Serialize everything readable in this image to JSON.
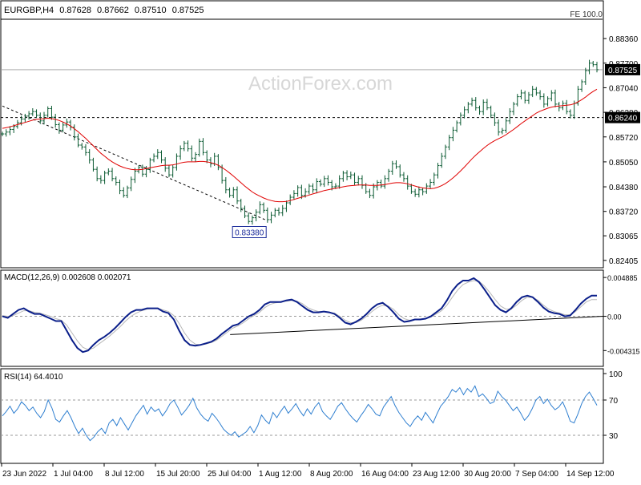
{
  "header": {
    "symbol": "EURGBP,H4",
    "ohlc": [
      "0.87628",
      "0.87662",
      "0.87510",
      "0.87525"
    ],
    "fe_label": "FE 100.0"
  },
  "watermark": "ActionForex.com",
  "colors": {
    "price": "#0b5a32",
    "ma": "#e00000",
    "macd": "#0b1f8a",
    "signal": "#b8b8b8",
    "rsi": "#2f7fd0",
    "frame": "#000000",
    "grid": "#9a9a9a"
  },
  "chart_data": [
    {
      "name": "price",
      "type": "line",
      "title": "EURGBP,H4",
      "y_ticks": [
        "0.88360",
        "0.87700",
        "0.87040",
        "0.86380",
        "0.85720",
        "0.85050",
        "0.84380",
        "0.83720",
        "0.83065",
        "0.82405"
      ],
      "ylim": [
        0.8225,
        0.8875
      ],
      "current_price": {
        "value": 0.87525,
        "label": "0.87525"
      },
      "support_level": {
        "value": 0.8624,
        "label": "0.86240"
      },
      "low_annotation": {
        "value": 0.8338,
        "label": "0.83380",
        "index": 65
      },
      "trendline": {
        "from": [
          0,
          0.8655
        ],
        "to": [
          70,
          0.8347
        ]
      },
      "series": [
        {
          "values": [
            0.858,
            0.8585,
            0.8592,
            0.86,
            0.861,
            0.862,
            0.8628,
            0.8634,
            0.864,
            0.863,
            0.8615,
            0.863,
            0.8648,
            0.8625,
            0.8605,
            0.859,
            0.8604,
            0.8612,
            0.8598,
            0.8572,
            0.855,
            0.8545,
            0.853,
            0.851,
            0.8485,
            0.846,
            0.8455,
            0.8475,
            0.848,
            0.846,
            0.845,
            0.8428,
            0.8415,
            0.8435,
            0.8458,
            0.848,
            0.849,
            0.8472,
            0.8485,
            0.851,
            0.852,
            0.853,
            0.851,
            0.8488,
            0.847,
            0.849,
            0.852,
            0.854,
            0.8555,
            0.854,
            0.8515,
            0.8525,
            0.856,
            0.853,
            0.851,
            0.85,
            0.852,
            0.849,
            0.8455,
            0.843,
            0.8415,
            0.843,
            0.84,
            0.838,
            0.836,
            0.8345,
            0.8355,
            0.837,
            0.839,
            0.8375,
            0.835,
            0.8362,
            0.8375,
            0.8368,
            0.838,
            0.8395,
            0.841,
            0.842,
            0.8436,
            0.8415,
            0.8425,
            0.844,
            0.843,
            0.8452,
            0.8445,
            0.846,
            0.845,
            0.8438,
            0.844,
            0.846,
            0.8475,
            0.8465,
            0.847,
            0.845,
            0.846,
            0.8442,
            0.8425,
            0.8415,
            0.8438,
            0.845,
            0.844,
            0.846,
            0.848,
            0.85,
            0.8492,
            0.847,
            0.846,
            0.844,
            0.8425,
            0.8418,
            0.843,
            0.8425,
            0.844,
            0.845,
            0.847,
            0.8495,
            0.852,
            0.8545,
            0.857,
            0.859,
            0.861,
            0.863,
            0.8645,
            0.866,
            0.867,
            0.865,
            0.864,
            0.8665,
            0.865,
            0.863,
            0.861,
            0.8585,
            0.859,
            0.8615,
            0.864,
            0.866,
            0.868,
            0.869,
            0.867,
            0.8685,
            0.87,
            0.869,
            0.868,
            0.866,
            0.8675,
            0.869,
            0.866,
            0.865,
            0.8662,
            0.864,
            0.863,
            0.8662,
            0.87,
            0.872,
            0.875,
            0.877,
            0.8766,
            0.87525
          ]
        },
        {
          "name": "ma",
          "values": [
            0.8595,
            0.8597,
            0.8599,
            0.8602,
            0.8605,
            0.8608,
            0.8611,
            0.8614,
            0.8617,
            0.8619,
            0.862,
            0.8621,
            0.8622,
            0.8621,
            0.8619,
            0.8616,
            0.8612,
            0.8607,
            0.8601,
            0.8594,
            0.8586,
            0.8577,
            0.8568,
            0.8558,
            0.8548,
            0.8538,
            0.8528,
            0.852,
            0.8512,
            0.8505,
            0.8499,
            0.8494,
            0.849,
            0.8487,
            0.8485,
            0.8484,
            0.8484,
            0.8485,
            0.8487,
            0.8489,
            0.8491,
            0.8493,
            0.8495,
            0.8496,
            0.8496,
            0.8497,
            0.8499,
            0.8502,
            0.8504,
            0.8505,
            0.8505,
            0.8505,
            0.8506,
            0.8506,
            0.8505,
            0.8503,
            0.85,
            0.8496,
            0.849,
            0.8483,
            0.8475,
            0.8467,
            0.8458,
            0.8449,
            0.844,
            0.8432,
            0.8424,
            0.8418,
            0.8413,
            0.8408,
            0.8404,
            0.8401,
            0.8399,
            0.8398,
            0.8398,
            0.8399,
            0.8401,
            0.8404,
            0.8407,
            0.841,
            0.8413,
            0.8416,
            0.8419,
            0.8422,
            0.8425,
            0.8428,
            0.843,
            0.8432,
            0.8434,
            0.8436,
            0.8438,
            0.844,
            0.8441,
            0.8442,
            0.8443,
            0.8443,
            0.8443,
            0.8442,
            0.8442,
            0.8442,
            0.8443,
            0.8444,
            0.8446,
            0.8448,
            0.8449,
            0.8449,
            0.8448,
            0.8446,
            0.8443,
            0.844,
            0.8437,
            0.8435,
            0.8434,
            0.8433,
            0.8434,
            0.8437,
            0.8441,
            0.8447,
            0.8454,
            0.8462,
            0.8471,
            0.8481,
            0.8491,
            0.8502,
            0.8513,
            0.8523,
            0.8532,
            0.8541,
            0.8549,
            0.8556,
            0.8562,
            0.8567,
            0.8572,
            0.8578,
            0.8585,
            0.8592,
            0.86,
            0.8608,
            0.8615,
            0.8622,
            0.8629,
            0.8636,
            0.8641,
            0.8645,
            0.8649,
            0.8652,
            0.8654,
            0.8655,
            0.8656,
            0.8657,
            0.8658,
            0.8661,
            0.8666,
            0.8672,
            0.8679,
            0.8687,
            0.8694,
            0.87
          ]
        }
      ]
    },
    {
      "name": "macd",
      "type": "line",
      "title": "MACD(12,26,9) 0.002608 0.002071",
      "y_ticks": [
        "0.004885",
        "0.00",
        "-0.004315"
      ],
      "ylim": [
        -0.0062,
        0.005
      ],
      "trendline": {
        "from": [
          90,
          -0.0023
        ],
        "to": [
          235,
          0.0
        ]
      },
      "series": [
        {
          "name": "MACD",
          "values": [
            0.0,
            -0.0002,
            0.0003,
            0.0008,
            0.001,
            0.0006,
            0.0003,
            0.0003,
            0.0,
            -0.0003,
            -0.0006,
            -0.0006,
            -0.0018,
            -0.003,
            -0.004,
            -0.0045,
            -0.0043,
            -0.0036,
            -0.003,
            -0.0026,
            -0.0021,
            -0.0015,
            -0.0008,
            -0.0001,
            0.0005,
            0.0008,
            0.0008,
            0.001,
            0.001,
            0.001,
            0.0006,
            0.0004,
            -0.0004,
            -0.0018,
            -0.003,
            -0.0036,
            -0.0037,
            -0.0036,
            -0.0034,
            -0.0032,
            -0.0028,
            -0.0022,
            -0.0017,
            -0.0012,
            -0.001,
            -0.0005,
            0.0,
            0.0003,
            0.0008,
            0.0015,
            0.0018,
            0.0018,
            0.0018,
            0.002,
            0.0021,
            0.0018,
            0.0013,
            0.0008,
            0.0005,
            0.0005,
            0.0006,
            0.0005,
            0.0003,
            -0.0002,
            -0.0008,
            -0.001,
            -0.0007,
            -0.0003,
            0.0003,
            0.001,
            0.0015,
            0.0017,
            0.0012,
            0.0005,
            -0.0003,
            -0.0007,
            -0.0006,
            -0.0004,
            -0.0004,
            -0.0003,
            0.0,
            0.0005,
            0.001,
            0.002,
            0.0032,
            0.004,
            0.0045,
            0.0045,
            0.0048,
            0.0043,
            0.0034,
            0.0024,
            0.0014,
            0.0008,
            0.0005,
            0.001,
            0.0018,
            0.0024,
            0.0026,
            0.0024,
            0.0018,
            0.0011,
            0.0006,
            0.0004,
            0.0003,
            0.0,
            0.0001,
            0.0008,
            0.0016,
            0.0022,
            0.0026,
            0.0026
          ]
        },
        {
          "name": "Signal",
          "values": [
            0.0001,
            0.0,
            0.0001,
            0.0004,
            0.0007,
            0.0007,
            0.0005,
            0.0004,
            0.0002,
            0.0,
            -0.0003,
            -0.0005,
            -0.0011,
            -0.0021,
            -0.0031,
            -0.0039,
            -0.0042,
            -0.004,
            -0.0035,
            -0.003,
            -0.0025,
            -0.0019,
            -0.0013,
            -0.0006,
            0.0,
            0.0004,
            0.0007,
            0.0009,
            0.001,
            0.001,
            0.0008,
            0.0006,
            0.0001,
            -0.0009,
            -0.0021,
            -0.003,
            -0.0035,
            -0.0036,
            -0.0035,
            -0.0033,
            -0.003,
            -0.0025,
            -0.002,
            -0.0015,
            -0.0012,
            -0.0008,
            -0.0003,
            0.0001,
            0.0005,
            0.0011,
            0.0015,
            0.0017,
            0.0018,
            0.0019,
            0.002,
            0.0019,
            0.0016,
            0.0011,
            0.0008,
            0.0006,
            0.0006,
            0.0005,
            0.0004,
            0.0,
            -0.0005,
            -0.0008,
            -0.0008,
            -0.0005,
            0.0,
            0.0006,
            0.0011,
            0.0014,
            0.0013,
            0.0009,
            0.0002,
            -0.0003,
            -0.0005,
            -0.0004,
            -0.0004,
            -0.0003,
            -0.0001,
            0.0003,
            0.0007,
            0.0014,
            0.0024,
            0.0033,
            0.004,
            0.0043,
            0.0045,
            0.0044,
            0.0038,
            0.003,
            0.0021,
            0.0013,
            0.0009,
            0.0009,
            0.0014,
            0.002,
            0.0024,
            0.0024,
            0.002,
            0.0014,
            0.0009,
            0.0006,
            0.0004,
            0.0002,
            0.0002,
            0.0006,
            0.0012,
            0.0018,
            0.0021,
            0.0021
          ]
        }
      ]
    },
    {
      "name": "rsi",
      "type": "line",
      "title": "RSI(14) 64.4010",
      "y_ticks": [
        "100",
        "70",
        "30",
        "0"
      ],
      "ylim": [
        0,
        100
      ],
      "levels": [
        70,
        30
      ],
      "series": [
        {
          "values": [
            52,
            57,
            63,
            55,
            60,
            68,
            64,
            58,
            62,
            55,
            50,
            57,
            70,
            61,
            48,
            45,
            52,
            58,
            50,
            40,
            32,
            38,
            30,
            24,
            28,
            34,
            38,
            32,
            44,
            48,
            41,
            50,
            43,
            36,
            44,
            52,
            58,
            64,
            54,
            62,
            57,
            60,
            52,
            58,
            66,
            70,
            62,
            53,
            58,
            64,
            72,
            61,
            54,
            49,
            46,
            55,
            50,
            44,
            37,
            33,
            30,
            34,
            28,
            31,
            34,
            40,
            33,
            41,
            53,
            47,
            43,
            56,
            50,
            57,
            63,
            55,
            60,
            66,
            58,
            52,
            60,
            54,
            62,
            67,
            57,
            52,
            48,
            55,
            63,
            67,
            60,
            54,
            49,
            45,
            52,
            58,
            65,
            60,
            54,
            52,
            62,
            68,
            74,
            64,
            56,
            50,
            44,
            40,
            47,
            52,
            47,
            56,
            50,
            44,
            54,
            63,
            68,
            74,
            82,
            79,
            84,
            76,
            83,
            79,
            86,
            74,
            77,
            72,
            66,
            68,
            80,
            74,
            70,
            64,
            58,
            62,
            55,
            47,
            52,
            60,
            70,
            74,
            66,
            71,
            64,
            59,
            62,
            68,
            58,
            46,
            44,
            54,
            66,
            74,
            79,
            72,
            64
          ]
        }
      ]
    }
  ],
  "x_axis": {
    "labels": [
      "23 Jun 2022",
      "1 Jul 04:00",
      "8 Jul 12:00",
      "15 Jul 20:00",
      "25 Jul 04:00",
      "1 Aug 12:00",
      "8 Aug 20:00",
      "16 Aug 04:00",
      "23 Aug 12:00",
      "30 Aug 20:00",
      "7 Sep 04:00",
      "14 Sep 12:00"
    ]
  }
}
